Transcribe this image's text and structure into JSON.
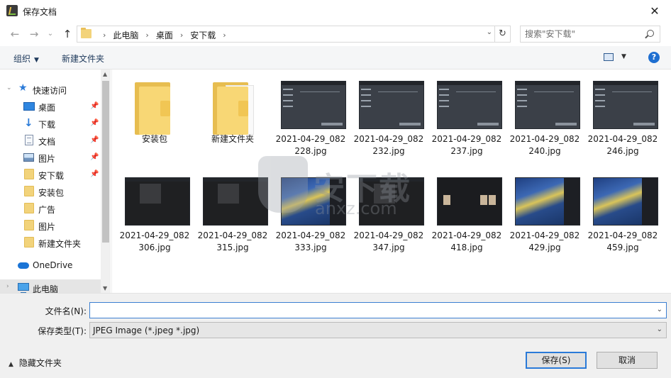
{
  "window": {
    "title": "保存文档",
    "close": "✕"
  },
  "nav": {
    "crumbs": [
      "此电脑",
      "桌面",
      "安下载"
    ],
    "search_placeholder": "搜索\"安下载\""
  },
  "toolbar": {
    "organize": "组织",
    "new_folder": "新建文件夹"
  },
  "sidebar": {
    "quick_access": "快速访问",
    "items": [
      {
        "label": "桌面",
        "icon": "desktop-icon",
        "pinned": true
      },
      {
        "label": "下载",
        "icon": "download-icon",
        "pinned": true
      },
      {
        "label": "文档",
        "icon": "document-icon",
        "pinned": true
      },
      {
        "label": "图片",
        "icon": "pictures-icon",
        "pinned": true
      },
      {
        "label": "安下载",
        "icon": "folder-icon",
        "pinned": true
      },
      {
        "label": "安装包",
        "icon": "folder-icon",
        "pinned": false
      },
      {
        "label": "广告",
        "icon": "folder-icon",
        "pinned": false
      },
      {
        "label": "图片",
        "icon": "folder-icon",
        "pinned": false
      },
      {
        "label": "新建文件夹",
        "icon": "folder-icon",
        "pinned": false
      }
    ],
    "onedrive": "OneDrive",
    "this_pc": "此电脑"
  },
  "files": [
    {
      "name": "安装包",
      "kind": "folder"
    },
    {
      "name": "新建文件夹",
      "kind": "folder-doc"
    },
    {
      "name": "2021-04-29_082\n228.jpg",
      "kind": "setup"
    },
    {
      "name": "2021-04-29_082\n232.jpg",
      "kind": "setup"
    },
    {
      "name": "2021-04-29_082\n237.jpg",
      "kind": "setup"
    },
    {
      "name": "2021-04-29_082\n240.jpg",
      "kind": "setup"
    },
    {
      "name": "2021-04-29_082\n246.jpg",
      "kind": "setup"
    },
    {
      "name": "2021-04-29_082\n306.jpg",
      "kind": "dark"
    },
    {
      "name": "2021-04-29_082\n315.jpg",
      "kind": "dark"
    },
    {
      "name": "2021-04-29_082\n333.jpg",
      "kind": "night"
    },
    {
      "name": "2021-04-29_082\n347.jpg",
      "kind": "dark"
    },
    {
      "name": "2021-04-29_082\n418.jpg",
      "kind": "gallery"
    },
    {
      "name": "2021-04-29_082\n429.jpg",
      "kind": "night"
    },
    {
      "name": "2021-04-29_082\n459.jpg",
      "kind": "night"
    }
  ],
  "watermark": {
    "text": "安下载",
    "sub": "anxz.com"
  },
  "form": {
    "filename_label": "文件名(N):",
    "filename_value": "",
    "filetype_label": "保存类型(T):",
    "filetype_value": "JPEG Image (*.jpeg *.jpg)"
  },
  "footer": {
    "hide_folders": "隐藏文件夹",
    "save": "保存(S)",
    "cancel": "取消"
  }
}
